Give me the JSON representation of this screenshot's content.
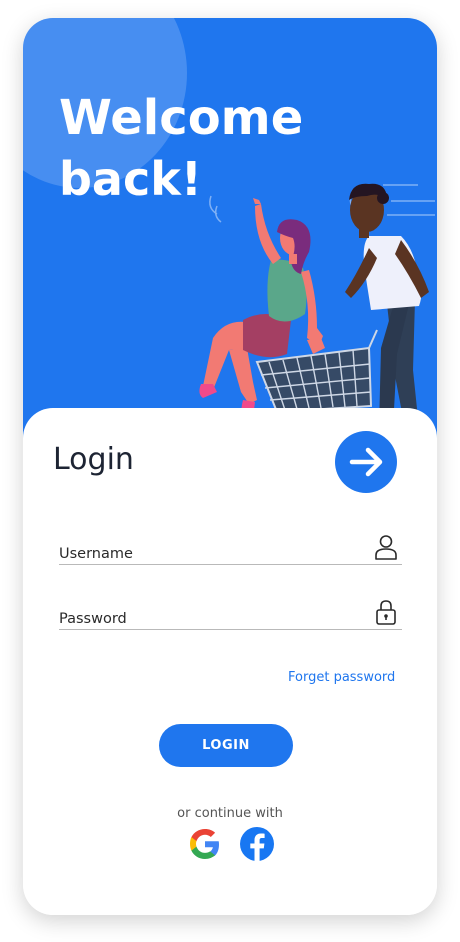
{
  "hero": {
    "title_line1": "Welcome",
    "title_line2": "back!",
    "background_color": "#1f76ee",
    "illustration": "two-people-shopping-cart-illustration"
  },
  "login": {
    "title": "Login",
    "submit_arrow_icon": "arrow-right-icon",
    "username_label": "Username",
    "username_icon": "user-icon",
    "password_label": "Password",
    "password_icon": "lock-icon",
    "forgot_password": "Forget password",
    "login_button": "LOGIN",
    "continue_with": "or continue with",
    "social": [
      {
        "name": "Google",
        "icon": "google-icon"
      },
      {
        "name": "Facebook",
        "icon": "facebook-icon"
      }
    ]
  },
  "colors": {
    "accent": "#1f76ee",
    "text_dark": "#1d2433",
    "underline": "#b9b9b9"
  }
}
